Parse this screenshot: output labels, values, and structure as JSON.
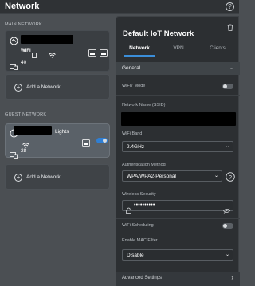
{
  "header": {
    "title": "Network",
    "help_glyph": "?"
  },
  "main_network": {
    "section_label": "MAIN NETWORK",
    "card": {
      "badge": "WiFi",
      "count": "40"
    },
    "add_label": "Add a Network"
  },
  "guest_network": {
    "section_label": "GUEST NETWORK",
    "card": {
      "name_suffix": "Lights",
      "count": "28",
      "enabled": true
    },
    "add_label": "Add a Network"
  },
  "panel": {
    "title": "Default IoT Network",
    "tabs": [
      {
        "label": "Network",
        "active": true
      },
      {
        "label": "VPN",
        "active": false
      },
      {
        "label": "Clients",
        "active": false
      }
    ],
    "general": {
      "label": "General",
      "expanded": true
    },
    "wifi7_mode": {
      "label": "WiFi7 Mode",
      "enabled": false
    },
    "ssid": {
      "label": "Network Name (SSID)"
    },
    "wifi_band": {
      "label": "WiFi Band",
      "value": "2.4GHz"
    },
    "auth_method": {
      "label": "Authentication Method",
      "value": "WPA/WPA2-Personal"
    },
    "wireless_security": {
      "label": "Wireless Security",
      "value": "••••••••••"
    },
    "wifi_scheduling": {
      "label": "WiFi Scheduling",
      "enabled": false
    },
    "mac_filter": {
      "label": "Enable MAC Filter",
      "value": "Disable"
    },
    "advanced": {
      "label": "Advanced Settings"
    }
  },
  "colors": {
    "accent": "#2f7fd4",
    "tab_underline": "#3b8ed9",
    "panel_bg": "#2c2f32",
    "page_bg": "#4b4f53"
  }
}
